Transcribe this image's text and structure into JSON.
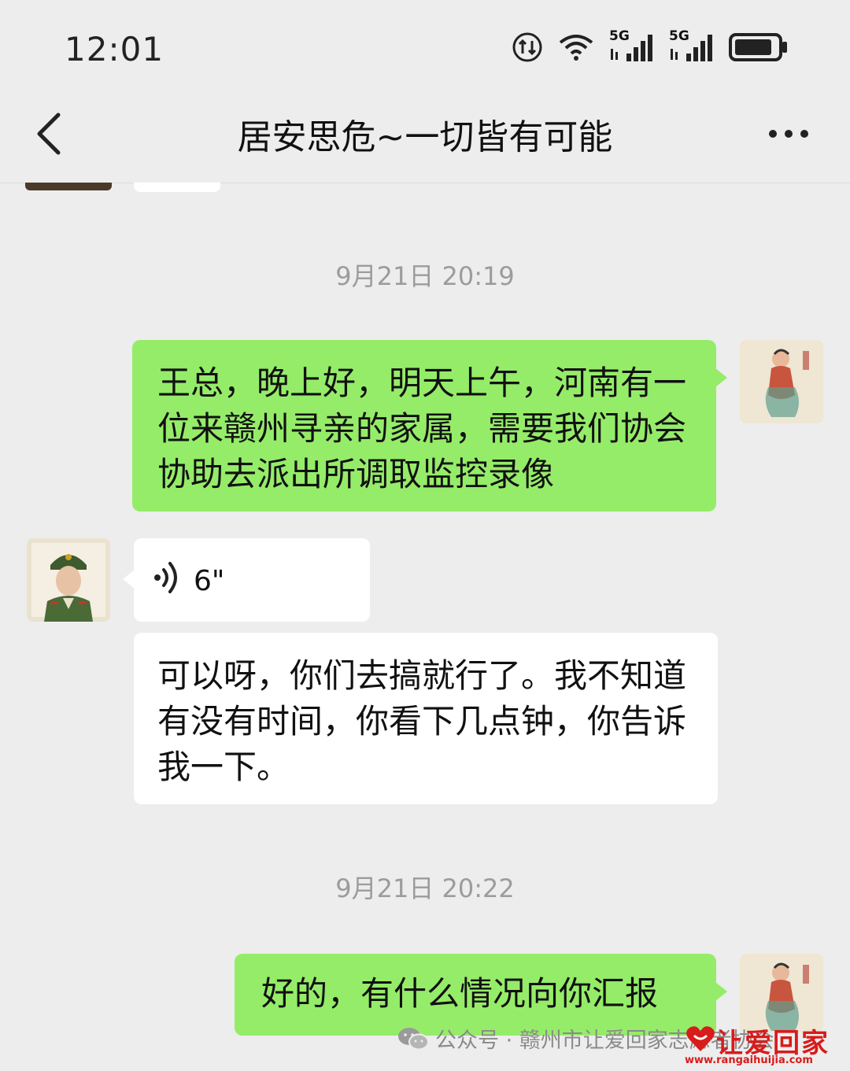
{
  "status": {
    "time": "12:01",
    "net1": "5G",
    "net2": "5G"
  },
  "header": {
    "title": "居安思危~一切皆有可能"
  },
  "messages": [
    {
      "timestamp": "9月21日 20:19"
    },
    {
      "text": "王总，晚上好，明天上午，河南有一位来赣州寻亲的家属，需要我们协会协助去派出所调取监控录像"
    },
    {
      "voice": "6\""
    },
    {
      "text": "可以呀，你们去搞就行了。我不知道有没有时间，你看下几点钟，你告诉我一下。"
    },
    {
      "timestamp": "9月21日 20:22"
    },
    {
      "text": "好的，有什么情况向你汇报"
    }
  ],
  "watermark": {
    "text": "公众号 · 赣州市让爱回家志愿者协会"
  },
  "logo": {
    "text": "让爱回家",
    "url": "www.rangaihuijia.com"
  },
  "colors": {
    "background": "#ededed",
    "sent_bubble": "#95ec69",
    "recv_bubble": "#ffffff"
  }
}
